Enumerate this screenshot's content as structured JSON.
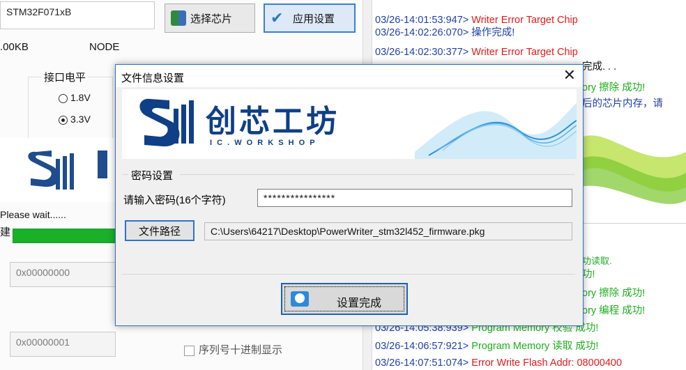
{
  "background_window": {
    "chip_model": "STM32F071xB",
    "size_label": ".00KB",
    "node_label": "NODE",
    "select_chip_button": "选择芯片",
    "apply_settings_button": "应用设置",
    "voltage_group_label": "接口电平",
    "voltage_options": [
      "1.8V",
      "3.3V"
    ],
    "selected_voltage": "3.3V",
    "please_wait": "Please wait......",
    "partial_label": "建",
    "progress": 1.0,
    "address_field_1": "0x00000000",
    "address_field_2": "0x00000001",
    "serial_decimal_checkbox": "序列号十进制显示"
  },
  "log": {
    "lines_top": [
      {
        "ts": "03/26-14:01:53:947>",
        "msg": " Writer Error Target Chip",
        "color": "red"
      },
      {
        "ts": "03/26-14:02:26:070>",
        "msg": " 操作完成!",
        "color": "blue"
      },
      {
        "ts": "03/26-14:02:30:377>",
        "msg": " Writer Error Target Chip",
        "color": "red"
      }
    ],
    "partial_right": [
      {
        "text": "完成. . .",
        "color": "blue"
      },
      {
        "text": "ory 擦除  成功!",
        "color": "green"
      },
      {
        "text": "后的芯片内存，请",
        "color": "blue"
      }
    ],
    "partial_right_lower": [
      {
        "text": "功读取.",
        "color": "green"
      },
      {
        "text": "功!",
        "color": "green"
      },
      {
        "text": "ory 擦除  成功!",
        "color": "green"
      },
      {
        "text": "ory 编程  成功!",
        "color": "green"
      }
    ],
    "lines_bottom": [
      {
        "ts": "03/26-14:05:38:939>",
        "msg": " Program Memory 校验  成功!",
        "color": "green"
      },
      {
        "ts": "03/26-14:06:57:921>",
        "msg": " Program Memory 读取  成功!",
        "color": "green"
      },
      {
        "ts": "03/26-14:07:51:074>",
        "msg": " Error Write Flash Addr: 08000400",
        "color": "red"
      }
    ]
  },
  "dialog": {
    "title": "文件信息设置",
    "close_glyph": "✕",
    "logo_cn": "创芯工坊",
    "logo_en": "I C . W O R K S H O P",
    "password_group": "密码设置",
    "password_prompt": "请输入密码(16个字符)",
    "password_value": "****************",
    "path_button": "文件路径",
    "path_value": "C:\\Users\\64217\\Desktop\\PowerWriter_stm32l452_firmware.pkg",
    "done_button": "设置完成"
  },
  "colors": {
    "accent_blue": "#2b71c7",
    "log_timestamp": "#1f3fa8",
    "log_error": "#e21b1b",
    "log_success": "#1fae1f",
    "progress_green": "#1ab02a"
  }
}
